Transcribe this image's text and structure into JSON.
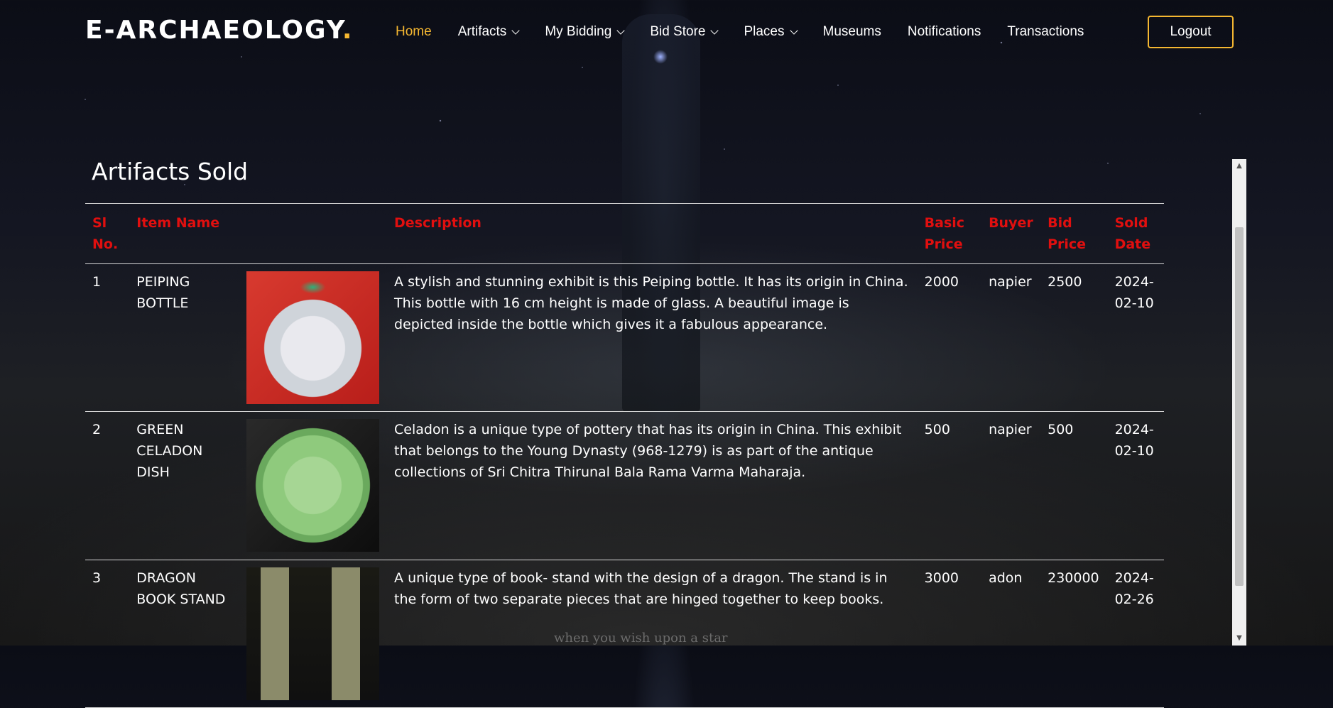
{
  "brand": {
    "name": "E-ARCHAEOLOGY",
    "dot": ".",
    "accent": "#f5b731"
  },
  "nav": [
    {
      "label": "Home",
      "active": true,
      "dropdown": false
    },
    {
      "label": "Artifacts",
      "active": false,
      "dropdown": true
    },
    {
      "label": "My Bidding",
      "active": false,
      "dropdown": true
    },
    {
      "label": "Bid Store",
      "active": false,
      "dropdown": true
    },
    {
      "label": "Places",
      "active": false,
      "dropdown": true
    },
    {
      "label": "Museums",
      "active": false,
      "dropdown": false
    },
    {
      "label": "Notifications",
      "active": false,
      "dropdown": false
    },
    {
      "label": "Transactions",
      "active": false,
      "dropdown": false
    }
  ],
  "logout_label": "Logout",
  "page_title": "Artifacts Sold",
  "table": {
    "header_color": "#e10f0f",
    "headers": {
      "sl": "Sl No.",
      "item": "Item Name",
      "description": "Description",
      "basic": "Basic Price",
      "buyer": "Buyer",
      "bid": "Bid Price",
      "sold": "Sold Date"
    },
    "rows": [
      {
        "sl": "1",
        "item": "PEIPING BOTTLE",
        "image": "peiping-bottle-image",
        "description": "A stylish and stunning exhibit is this Peiping bottle. It has its origin in China. This bottle with 16 cm height is made of glass. A beautiful image is depicted inside the bottle which gives it a fabulous appearance.",
        "basic": "2000",
        "buyer": "napier",
        "bid": "2500",
        "sold": "2024-02-10"
      },
      {
        "sl": "2",
        "item": "GREEN CELADON DISH",
        "image": "celadon-dish-image",
        "description": "Celadon is a unique type of pottery that has its origin in China. This exhibit that belongs to the Young Dynasty (968-1279) is as part of the antique collections of Sri Chitra Thirunal Bala Rama Varma Maharaja.",
        "basic": "500",
        "buyer": "napier",
        "bid": "500",
        "sold": "2024-02-10"
      },
      {
        "sl": "3",
        "item": "DRAGON BOOK STAND",
        "image": "dragon-book-stand-image",
        "description": "A unique type of book- stand with the design of a dragon. The stand is in the form of two separate pieces that are hinged together to keep books.",
        "basic": "3000",
        "buyer": "adon",
        "bid": "230000",
        "sold": "2024-02-26"
      }
    ]
  },
  "background_caption": "when you wish upon a star"
}
